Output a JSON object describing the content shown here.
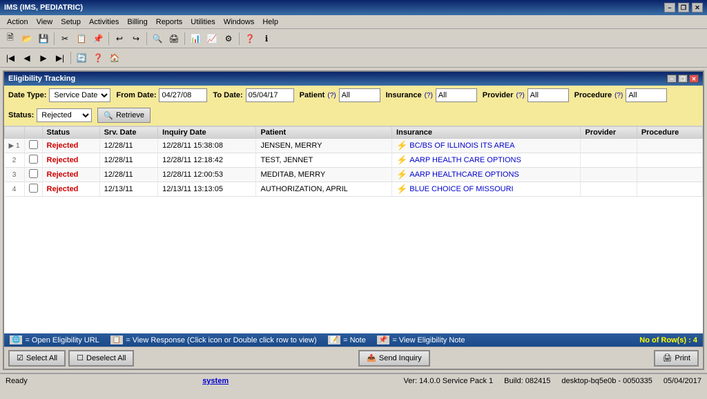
{
  "window": {
    "title": "IMS (IMS, PEDIATRIC)"
  },
  "titlebar": {
    "controls": [
      "–",
      "❐",
      "✕"
    ]
  },
  "menubar": {
    "items": [
      "Action",
      "View",
      "Setup",
      "Activities",
      "Billing",
      "Reports",
      "Utilities",
      "Windows",
      "Help"
    ]
  },
  "eligibility_window": {
    "title": "Eligibility Tracking",
    "filter": {
      "date_type_label": "Date Type:",
      "date_type_value": "Service Date",
      "from_date_label": "From Date:",
      "from_date_value": "04/27/08",
      "to_date_label": "To Date:",
      "to_date_value": "05/04/17",
      "patient_label": "Patient",
      "patient_help": "(?)",
      "patient_value": "All",
      "insurance_label": "Insurance",
      "insurance_help": "(?)",
      "insurance_value": "All",
      "provider_label": "Provider",
      "provider_help": "(?)",
      "provider_value": "All",
      "procedure_label": "Procedure",
      "procedure_help": "(?)",
      "procedure_value": "All",
      "status_label": "Status:",
      "status_value": "Rejected",
      "retrieve_label": "Retrieve"
    },
    "table": {
      "columns": [
        "",
        "Status",
        "Srv. Date",
        "Inquiry Date",
        "Patient",
        "Insurance",
        "Provider",
        "Procedure",
        ""
      ],
      "rows": [
        {
          "num": "1",
          "expand": true,
          "checkbox": false,
          "status": "Rejected",
          "srv_date": "12/28/11",
          "inquiry_date": "12/28/11 15:38:08",
          "patient": "JENSEN, MERRY",
          "insurance": "BC/BS OF ILLINOIS ITS AREA",
          "provider": "",
          "procedure": ""
        },
        {
          "num": "2",
          "expand": false,
          "checkbox": false,
          "status": "Rejected",
          "srv_date": "12/28/11",
          "inquiry_date": "12/28/11 12:18:42",
          "patient": "TEST, JENNET",
          "insurance": "AARP HEALTH CARE OPTIONS",
          "provider": "",
          "procedure": ""
        },
        {
          "num": "3",
          "expand": false,
          "checkbox": false,
          "status": "Rejected",
          "srv_date": "12/28/11",
          "inquiry_date": "12/28/11 12:00:53",
          "patient": "MEDITAB, MERRY",
          "insurance": "AARP HEALTHCARE OPTIONS",
          "provider": "",
          "procedure": ""
        },
        {
          "num": "4",
          "expand": false,
          "checkbox": false,
          "status": "Rejected",
          "srv_date": "12/13/11",
          "inquiry_date": "12/13/11 13:13:05",
          "patient": "AUTHORIZATION, APRIL",
          "insurance": "BLUE CHOICE OF MISSOURI",
          "provider": "",
          "procedure": ""
        }
      ]
    },
    "status_bar": {
      "legend1": "= Open Eligibility URL",
      "legend2": "= View Response (Click icon or Double click row to view)",
      "legend3": "= Note",
      "legend4": "= View Eligibility Note",
      "row_count_label": "No of Row(s) :",
      "row_count": "4"
    },
    "actions": {
      "select_all": "Select All",
      "deselect_all": "Deselect All",
      "send_inquiry": "Send Inquiry",
      "print": "Print"
    }
  },
  "footer": {
    "status": "Ready",
    "user": "system",
    "version": "Ver: 14.0.0 Service Pack 1",
    "build": "Build: 082415",
    "desktop": "desktop-bq5e0b - 0050335",
    "date": "05/04/2017"
  },
  "icons": {
    "retrieve": "🔍",
    "select_all": "☑",
    "deselect_all": "☐",
    "send_inquiry": "📤",
    "print": "🖨",
    "open_url": "🌐",
    "view_response": "📋",
    "note": "📝",
    "view_note": "📌"
  }
}
